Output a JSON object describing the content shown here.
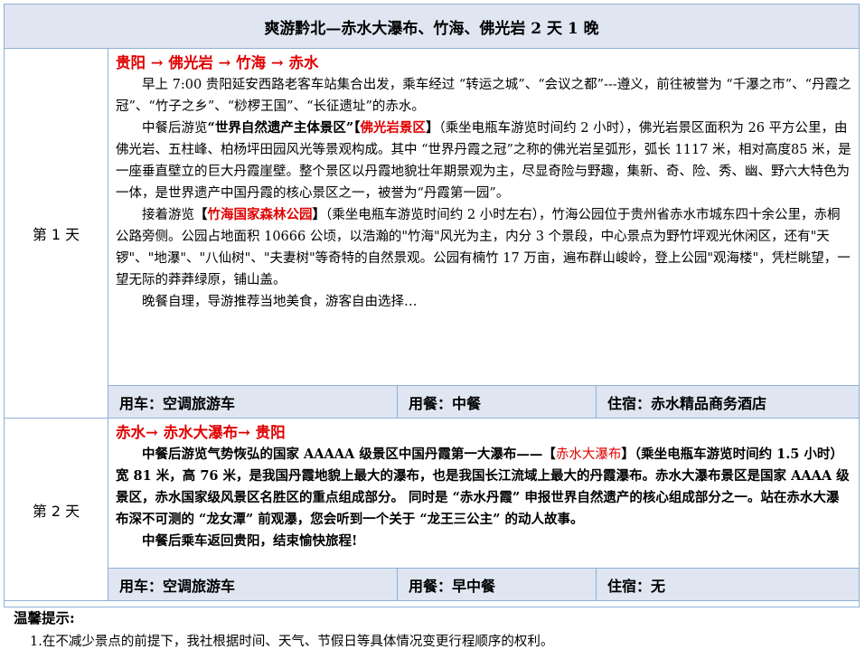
{
  "title": "爽游黔北—赤水大瀑布、竹海、佛光岩 2 天 1 晚",
  "days": [
    {
      "label": "第 1 天",
      "route": "贵阳 → 佛光岩 → 竹海 → 赤水",
      "p1": "早上 7:00 贵阳延安西路老客车站集合出发，乘车经过 “转运之城”、“会议之都”---遵义，前往被誉为 “千瀑之市”、“丹霞之冠”、“竹子之乡”、“桫椤王国”、“长征遗址”的赤水。",
      "p2_pre": "中餐后游览",
      "p2_bold": "“世界自然遗产主体景区”",
      "p2_bracket_open": "【",
      "p2_hl": "佛光岩景区",
      "p2_bracket_close": "】",
      "p2_rest": "（乘坐电瓶车游览时间约 2 小时），佛光岩景区面积为 26 平方公里，由佛光岩、五柱峰、柏杨坪田园风光等景观构成。其中 “世界丹霞之冠”之称的佛光岩呈弧形，弧长 1117 米，相对高度85 米，是一座垂直壁立的巨大丹霞崖壁。整个景区以丹霞地貌壮年期景观为主，尽显奇险与野趣，集新、奇、险、秀、幽、野六大特色为一体，是世界遗产中国丹霞的核心景区之一，被誉为“丹霞第一园”。",
      "p3_pre": "接着游览",
      "p3_bracket_open": "【",
      "p3_hl": "竹海国家森林公园",
      "p3_bracket_close": "】",
      "p3_rest": "（乘坐电瓶车游览时间约 2 小时左右），竹海公园位于贵州省赤水市城东四十余公里，赤桐公路旁侧。公园占地面积 10666 公顷，以浩瀚的\"竹海\"风光为主，内分 3 个景段，中心景点为野竹坪观光休闲区，还有\"天锣\"、\"地瀑\"、\"八仙树\"、\"夫妻树\"等奇特的自然景观。公园有楠竹 17 万亩，遍布群山峻岭，登上公园\"观海楼\"，凭栏眺望，一望无际的莽莽绿原，铺山盖。",
      "p4": "晚餐自理，导游推荐当地美食，游客自由选择…",
      "transport": "用车：空调旅游车",
      "meal": "用餐：中餐",
      "lodging": "住宿：赤水精品商务酒店"
    },
    {
      "label": "第 2 天",
      "route": "赤水→ 赤水大瀑布→ 贵阳",
      "p1_pre": "中餐后游览气势恢弘的国家 AAAAA 级景区中国丹霞第一大瀑布——",
      "p1_bracket_open": "【",
      "p1_hl": "赤水大瀑布",
      "p1_bracket_close": "】",
      "p1_rest": "（乘坐电瓶车游览时间约 1.5 小时）宽 81 米，高 76 米，是我国丹霞地貌上最大的瀑布，也是我国长江流域上最大的丹霞瀑布。赤水大瀑布景区是国家 AAAA 级景区，赤水国家级风景区名胜区的重点组成部分。 同时是 “赤水丹霞” 申报世界自然遗产的核心组成部分之一。站在赤水大瀑布深不可测的 “龙女潭” 前观瀑，您会听到一个关于 “龙王三公主” 的动人故事。",
      "p2": "中餐后乘车返回贵阳，结束愉快旅程!",
      "transport": "用车：空调旅游车",
      "meal": "用餐：早中餐",
      "lodging": "住宿：无"
    }
  ],
  "tips": {
    "title": "温馨提示:",
    "items": [
      "1.在不减少景点的前提下，我社根据时间、天气、节假日等具体情况变更行程顺序的权利。"
    ]
  },
  "colors": {
    "header_bg": "#dfe6f1",
    "border": "#8fb0d6",
    "accent": "#e00000"
  }
}
